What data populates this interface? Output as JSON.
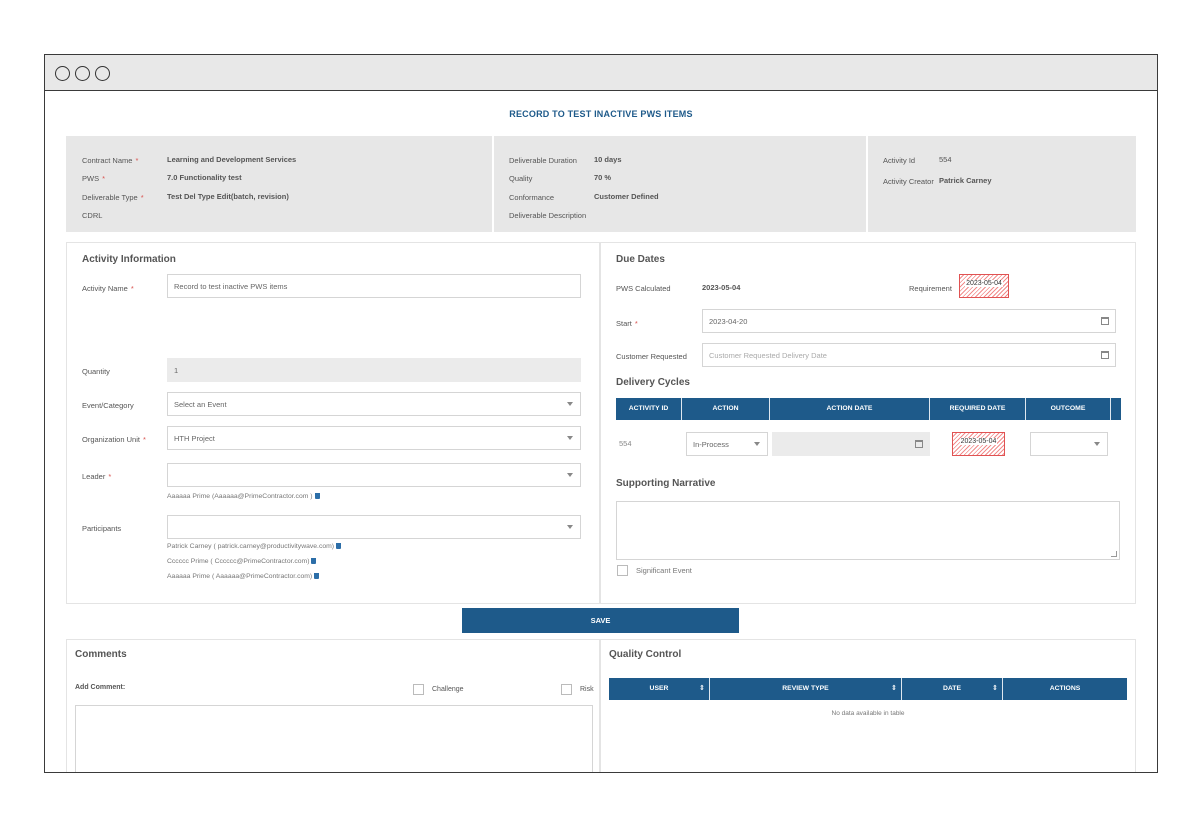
{
  "page_title": "RECORD TO TEST INACTIVE PWS ITEMS",
  "info": {
    "contract_name_label": "Contract Name",
    "contract_name": "Learning and Development Services",
    "pws_label": "PWS",
    "pws": "7.0 Functionality test",
    "deliverable_type_label": "Deliverable Type",
    "deliverable_type": "Test Del Type Edit(batch, revision)",
    "cdrl_label": "CDRL",
    "duration_label": "Deliverable Duration",
    "duration": "10 days",
    "quality_label": "Quality",
    "quality": "70 %",
    "conformance_label": "Conformance",
    "conformance": "Customer Defined",
    "description_label": "Deliverable Description",
    "activity_id_label": "Activity Id",
    "activity_id": "554",
    "activity_creator_label": "Activity Creator",
    "activity_creator": "Patrick Carney",
    "required_mark": "*"
  },
  "activity": {
    "title": "Activity Information",
    "name_label": "Activity Name",
    "name_value": "Record to test inactive PWS items",
    "quantity_label": "Quantity",
    "quantity_value": "1",
    "event_label": "Event/Category",
    "event_value": "Select an Event",
    "org_label": "Organization Unit",
    "org_value": "HTH Project",
    "leader_label": "Leader",
    "leader_people": [
      "Aaaaaa Prime (Aaaaaa@PrimeContractor.com )"
    ],
    "participants_label": "Participants",
    "participants": [
      "Patrick Carney ( patrick.carney@productivitywave.com)",
      "Cccccc Prime ( Cccccc@PrimeContractor.com)",
      "Aaaaaa Prime ( Aaaaaa@PrimeContractor.com)"
    ]
  },
  "due_dates": {
    "title": "Due Dates",
    "pws_calculated_label": "PWS Calculated",
    "pws_calculated": "2023-05-04",
    "requirement_label": "Requirement",
    "requirement": "2023-05-04",
    "start_label": "Start",
    "start": "2023-04-20",
    "customer_requested_label": "Customer Requested",
    "customer_requested_placeholder": "Customer Requested Delivery Date"
  },
  "delivery_cycles": {
    "title": "Delivery Cycles",
    "columns": [
      "ACTIVITY ID",
      "ACTION",
      "ACTION DATE",
      "REQUIRED DATE",
      "OUTCOME"
    ],
    "row": {
      "activity_id": "554",
      "action": "In-Process",
      "action_date": "",
      "required_date": "2023-05-04",
      "outcome": ""
    }
  },
  "narrative": {
    "title": "Supporting Narrative",
    "significant_event_label": "Significant Event"
  },
  "save_label": "SAVE",
  "comments": {
    "title": "Comments",
    "add_label": "Add Comment:",
    "challenge_label": "Challenge",
    "risk_label": "Risk"
  },
  "quality_control": {
    "title": "Quality Control",
    "columns": [
      "USER",
      "REVIEW TYPE",
      "DATE",
      "ACTIONS"
    ],
    "empty_text": "No data available in table"
  },
  "colors": {
    "primary": "#1e5a8a",
    "required": "#d9534f",
    "highlight": "#e05252"
  }
}
